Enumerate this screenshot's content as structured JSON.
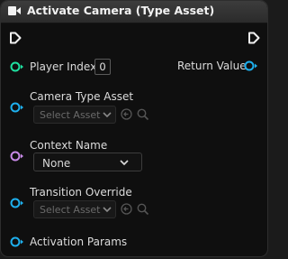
{
  "node": {
    "title": "Activate Camera (Type Asset)",
    "colors": {
      "background": "#0f0f0f",
      "header": "#363636",
      "exec_pin": "#f0f0f0",
      "integer_pin": "#1fe0a0",
      "object_pin": "#1eb0ee",
      "name_pin": "#c88ae8"
    },
    "icons": {
      "header": "camera-play-icon"
    }
  },
  "pins": {
    "exec_in": {
      "icon": "exec-pin-icon"
    },
    "exec_out": {
      "icon": "exec-pin-icon"
    },
    "player_index": {
      "label": "Player Index",
      "value": "0"
    },
    "return_value": {
      "label": "Return Value"
    },
    "camera_type_asset": {
      "label": "Camera Type Asset",
      "dropdown": "Select Asset"
    },
    "context_name": {
      "label": "Context Name",
      "dropdown": "None"
    },
    "transition_override": {
      "label": "Transition Override",
      "dropdown": "Select Asset"
    },
    "activation_params": {
      "label": "Activation Params"
    }
  }
}
